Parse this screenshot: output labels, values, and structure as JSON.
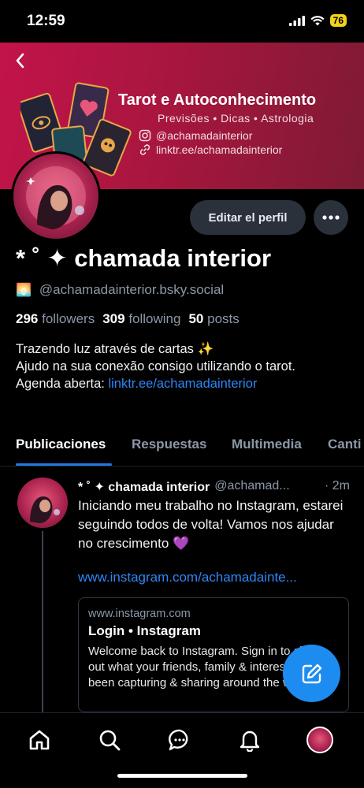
{
  "status_bar": {
    "time": "12:59",
    "battery": "76"
  },
  "banner": {
    "title": "Tarot e Autoconhecimento",
    "subtitle": "Previsões • Dicas • Astrologia",
    "instagram": "@achamadainterior",
    "link": "linktr.ee/achamadainterior"
  },
  "profile": {
    "display_name": "* ˚ ✦ chamada interior",
    "handle_emoji": "🌅",
    "handle": "@achamadainterior.bsky.social",
    "edit_label": "Editar el perfil",
    "stats": {
      "followers_count": "296",
      "followers_label": "followers",
      "following_count": "309",
      "following_label": "following",
      "posts_count": "50",
      "posts_label": "posts"
    },
    "bio": {
      "line1": "Trazendo luz através de cartas ✨",
      "line2": "Ajudo na sua conexão consigo utilizando o tarot.",
      "line3_prefix": "Agenda aberta: ",
      "line3_link": "linktr.ee/achamadainterior"
    }
  },
  "tabs": [
    {
      "label": "Publicaciones",
      "active": true
    },
    {
      "label": "Respuestas"
    },
    {
      "label": "Multimedia"
    },
    {
      "label": "Canti"
    }
  ],
  "post": {
    "author": "* ˚ ✦ chamada interior",
    "handle": "@achamad...",
    "time": "· 2m",
    "text": "Iniciando meu trabalho no Instagram, estarei seguindo todos de volta! Vamos nos ajudar no crescimento 💜",
    "link": "www.instagram.com/achamadainte...",
    "card": {
      "domain": "www.instagram.com",
      "title": "Login • Instagram",
      "description": "Welcome back to Instagram. Sign in to check out what your friends, family & interests have been capturing & sharing around the world."
    }
  },
  "nav": [
    "home-icon",
    "search-icon",
    "chat-icon",
    "bell-icon",
    "profile-avatar"
  ],
  "colors": {
    "accent": "#1d8cf0",
    "link": "#2f86f6",
    "banner": "#c2144a"
  }
}
